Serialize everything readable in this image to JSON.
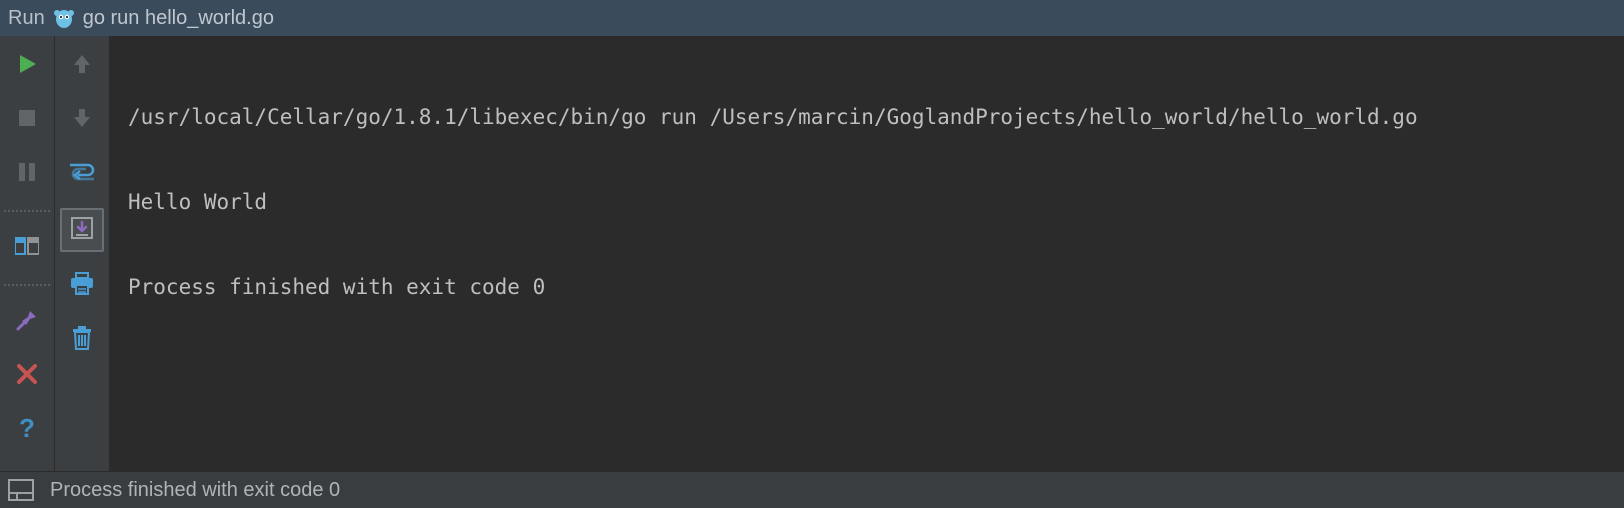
{
  "header": {
    "panel_label": "Run",
    "run_config": "go run hello_world.go"
  },
  "console": {
    "lines": [
      "/usr/local/Cellar/go/1.8.1/libexec/bin/go run /Users/marcin/GoglandProjects/hello_world/hello_world.go",
      "Hello World",
      "Process finished with exit code 0"
    ]
  },
  "status_bar": {
    "message": "Process finished with exit code 0"
  },
  "icons": {
    "gopher": "gopher-icon",
    "run": "run-icon",
    "stop": "stop-icon",
    "pause": "pause-icon",
    "layout": "layout-icon",
    "pin": "pin-icon",
    "close": "close-icon",
    "help": "help-icon",
    "up": "arrow-up-icon",
    "down": "arrow-down-icon",
    "wrap": "soft-wrap-icon",
    "scroll_end": "scroll-to-end-icon",
    "print": "print-icon",
    "clear": "clear-all-icon",
    "status_layout": "layout-icon"
  },
  "colors": {
    "bg_panel": "#3c3f41",
    "bg_console": "#2b2b2b",
    "bg_header": "#3a4b5c",
    "text": "#bfbfbf",
    "green": "#4caf50",
    "blue": "#4a9ed6",
    "purple": "#8a6bbf",
    "red": "#c75450"
  }
}
